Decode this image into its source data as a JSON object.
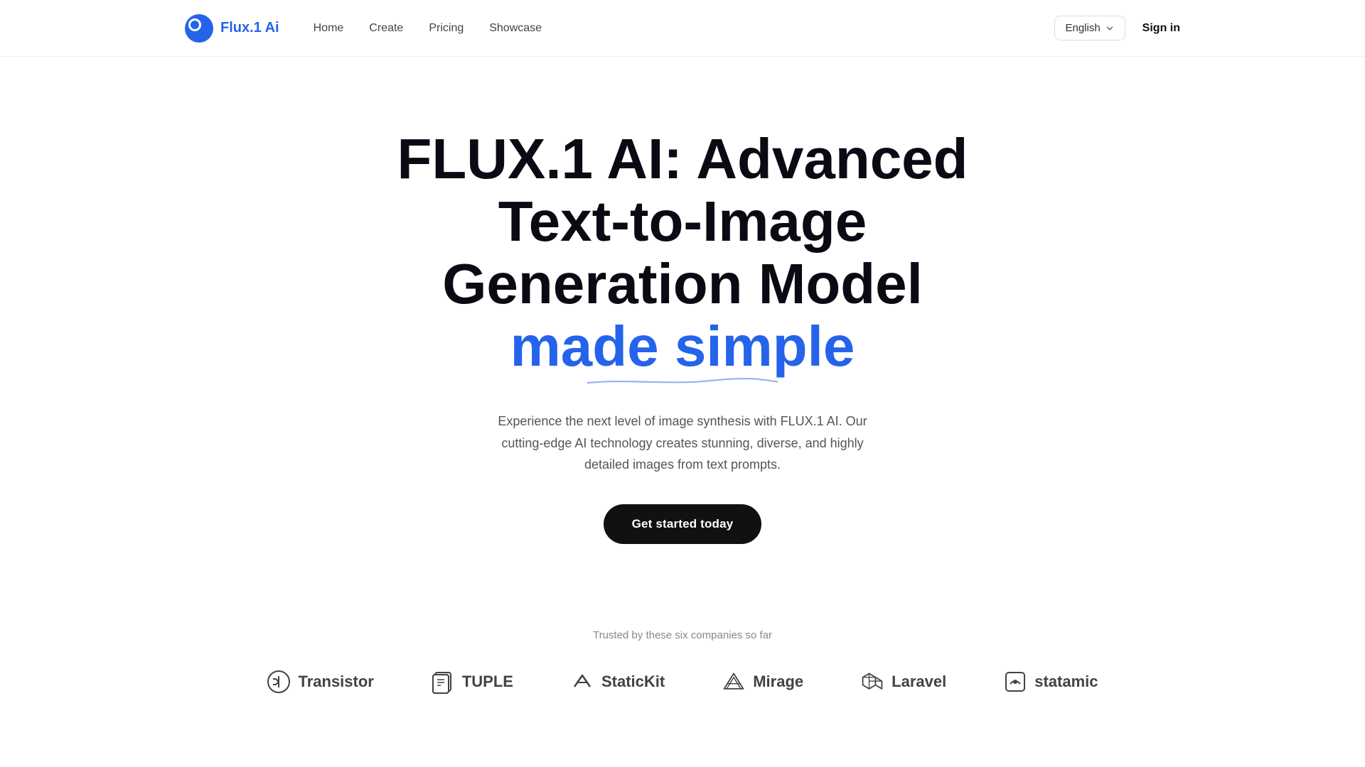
{
  "nav": {
    "logo_text": "Flux.1 Ai",
    "logo_brand": "Flux.1 ",
    "logo_accent": "Ai",
    "links": [
      {
        "label": "Home",
        "id": "home"
      },
      {
        "label": "Create",
        "id": "create"
      },
      {
        "label": "Pricing",
        "id": "pricing"
      },
      {
        "label": "Showcase",
        "id": "showcase"
      }
    ],
    "language": "English",
    "sign_in": "Sign in"
  },
  "hero": {
    "title_line1": "FLUX.1 AI: Advanced",
    "title_line2": "Text-to-Image",
    "title_line3": "Generation Model",
    "title_highlight": "made simple",
    "description": "Experience the next level of image synthesis with FLUX.1 AI. Our cutting-edge AI technology creates stunning, diverse, and highly detailed images from text prompts.",
    "cta": "Get started today"
  },
  "logos_section": {
    "label": "Trusted by these six companies so far",
    "companies": [
      {
        "name": "Transistor",
        "id": "transistor"
      },
      {
        "name": "TUPLE",
        "id": "tuple"
      },
      {
        "name": "StaticKit",
        "id": "statickit"
      },
      {
        "name": "Mirage",
        "id": "mirage"
      },
      {
        "name": "Laravel",
        "id": "laravel"
      },
      {
        "name": "statamic",
        "id": "statamic"
      }
    ]
  }
}
